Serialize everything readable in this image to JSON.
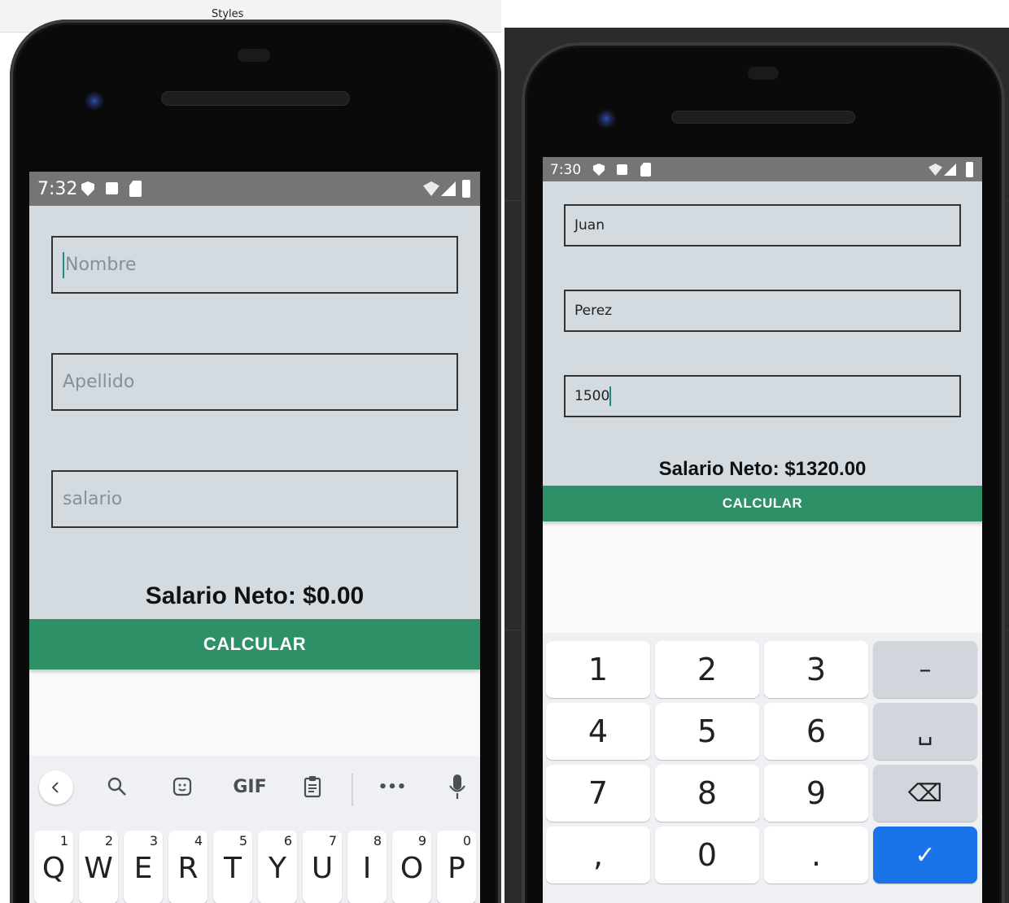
{
  "colors": {
    "app_bg": "#d3dae0",
    "accent_button": "#2e9067",
    "status_bar": "#757575",
    "confirm_key": "#1a73e8"
  },
  "left": {
    "top_strip_label": "Styles",
    "status": {
      "time": "7:32",
      "icons": [
        "shield-icon",
        "a-icon",
        "sdcard-icon",
        "wifi-icon",
        "signal-icon",
        "battery-icon"
      ]
    },
    "fields": [
      {
        "placeholder": "Nombre",
        "value": ""
      },
      {
        "placeholder": "Apellido",
        "value": ""
      },
      {
        "placeholder": "salario",
        "value": ""
      }
    ],
    "result_text": "Salario Neto: $0.00",
    "button_label": "CALCULAR",
    "keyboard": {
      "toolbar": [
        "back",
        "search-icon",
        "sticker-icon",
        "GIF",
        "clipboard-icon",
        "•••",
        "mic-icon"
      ],
      "gif_label": "GIF",
      "more_label": "•••",
      "keys": [
        {
          "letter": "Q",
          "num": "1"
        },
        {
          "letter": "W",
          "num": "2"
        },
        {
          "letter": "E",
          "num": "3"
        },
        {
          "letter": "R",
          "num": "4"
        },
        {
          "letter": "T",
          "num": "5"
        },
        {
          "letter": "Y",
          "num": "6"
        },
        {
          "letter": "U",
          "num": "7"
        },
        {
          "letter": "I",
          "num": "8"
        },
        {
          "letter": "O",
          "num": "9"
        },
        {
          "letter": "P",
          "num": "0"
        }
      ]
    }
  },
  "right": {
    "status": {
      "time": "7:30"
    },
    "fields": [
      {
        "value": "Juan"
      },
      {
        "value": "Perez"
      },
      {
        "value": "1500"
      }
    ],
    "result_text": "Salario Neto: $1320.00",
    "button_label": "CALCULAR",
    "numpad": [
      [
        "1",
        "2",
        "3",
        "–"
      ],
      [
        "4",
        "5",
        "6",
        "␣"
      ],
      [
        "7",
        "8",
        "9",
        "⌫"
      ],
      [
        ",",
        "0",
        ".",
        "✓"
      ]
    ]
  }
}
